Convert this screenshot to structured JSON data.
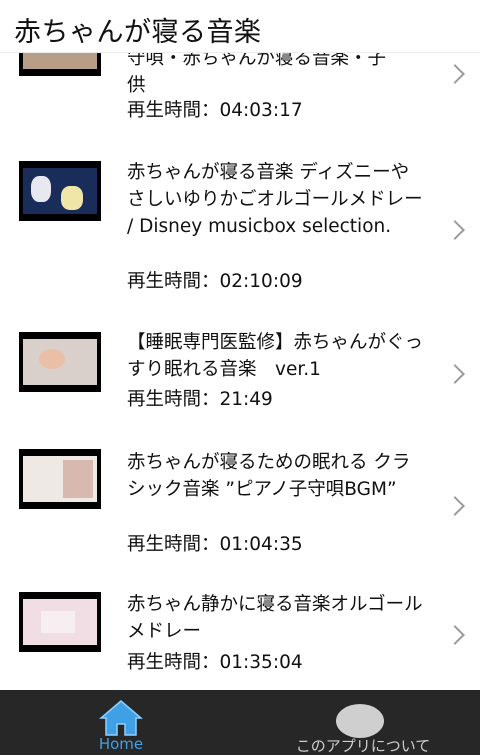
{
  "header": {
    "title": "赤ちゃんが寝る音楽"
  },
  "duration_label": "再生時間：",
  "items": [
    {
      "title_line1": "守唄・赤ちゃんが寝る音楽・子",
      "title_line2": "供",
      "duration": "04:03:17"
    },
    {
      "title": "赤ちゃんが寝る音楽 ディズニーやさしいゆりかごオルゴールメドレー / Disney musicbox selection.",
      "duration": "02:10:09"
    },
    {
      "title": "【睡眠専門医監修】赤ちゃんがぐっすり眠れる音楽　ver.1",
      "duration": "21:49"
    },
    {
      "title": "赤ちゃんが寝るための眠れる クラシック音楽 ”ピアノ子守唄BGM”",
      "duration": "01:04:35"
    },
    {
      "title": "赤ちゃん静かに寝る音楽オルゴールメドレー",
      "duration": "01:35:04"
    }
  ],
  "tabbar": {
    "home_label": "Home",
    "about_label": "このアプリについて"
  },
  "colors": {
    "tab_active": "#3fa0e6",
    "tab_bg": "#272727"
  }
}
